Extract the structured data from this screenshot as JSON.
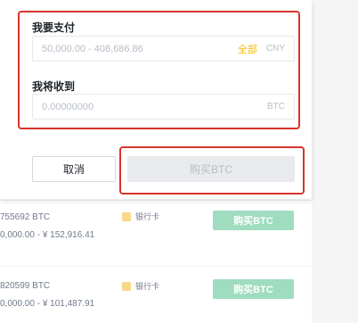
{
  "modal": {
    "pay_label": "我要支付",
    "pay_placeholder": "50,000.00 - 408,686.86",
    "pay_all": "全部",
    "pay_currency": "CNY",
    "receive_label": "我将收到",
    "receive_value": "0.00000000",
    "receive_currency": "BTC",
    "cancel_label": "取消",
    "buy_label": "购买BTC"
  },
  "offers": [
    {
      "amount": "755692 BTC",
      "range": "0,000.00 - ¥ 152,916.41",
      "payment": "银行卡",
      "buy_label": "购买BTC"
    },
    {
      "amount": "820599 BTC",
      "range": "0,000.00 - ¥ 101,487.91",
      "payment": "银行卡",
      "buy_label": "购买BTC"
    }
  ],
  "colors": {
    "highlight_red": "#d9342b",
    "all_link": "#f0b90b",
    "buy_green": "#9fdcc0",
    "disabled_button": "#e8eaed"
  }
}
